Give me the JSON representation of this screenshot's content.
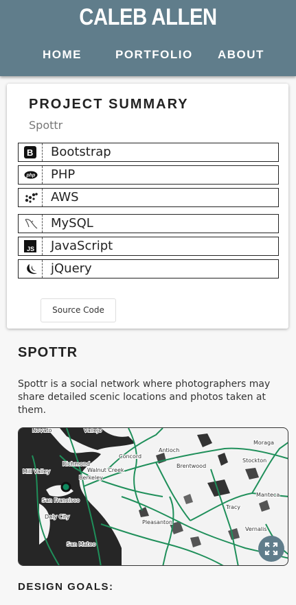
{
  "header": {
    "title": "CALEB ALLEN",
    "nav": [
      "HOME",
      "PORTFOLIO",
      "ABOUT"
    ]
  },
  "summary": {
    "title": "PROJECT SUMMARY",
    "project_name": "Spottr",
    "technologies": [
      {
        "label": "Bootstrap",
        "icon": "bootstrap-icon"
      },
      {
        "label": "PHP",
        "icon": "php-icon"
      },
      {
        "label": "AWS",
        "icon": "aws-icon"
      },
      {
        "label": "MySQL",
        "icon": "mysql-icon"
      },
      {
        "label": "JavaScript",
        "icon": "javascript-icon"
      },
      {
        "label": "jQuery",
        "icon": "jquery-icon"
      }
    ],
    "source_button": "Source Code"
  },
  "project": {
    "title": "SPOTTR",
    "description": "Spottr is a social network where photographers may share detailed scenic locations and photos taken at them."
  },
  "map": {
    "places": [
      "Novato",
      "Vallejo",
      "Concord",
      "Antioch",
      "Moraga",
      "Richmond",
      "Mill Valley",
      "Berkeley",
      "Walnut Creek",
      "Brentwood",
      "Stockton",
      "San Francisco",
      "Manteca",
      "Tracy",
      "Daly City",
      "Pleasanton",
      "Vernalis",
      "San Mateo"
    ],
    "marker_color": "#0f8a5f",
    "route_color": "#1f8f5a"
  },
  "goals": {
    "title": "DESIGN GOALS:"
  },
  "colors": {
    "header_bg": "#607d8b",
    "accent": "#607d8b"
  }
}
